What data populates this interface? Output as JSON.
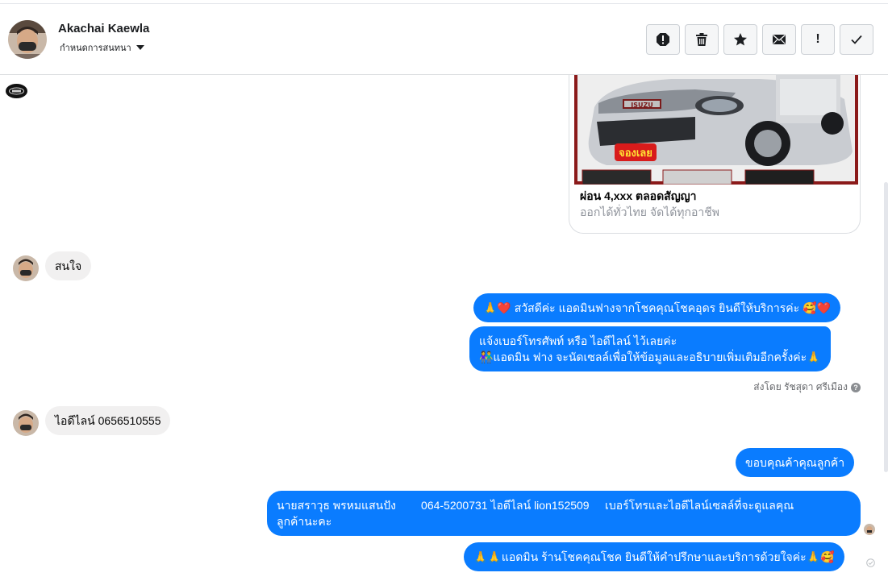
{
  "header": {
    "user_name": "Akachai Kaewla",
    "conversation_label": "กำหนดการสนทนา",
    "actions": [
      {
        "name": "report-icon",
        "label": "!"
      },
      {
        "name": "trash-icon"
      },
      {
        "name": "star-icon"
      },
      {
        "name": "mail-icon"
      },
      {
        "name": "mark-important-icon",
        "label": "!"
      },
      {
        "name": "checkmark-icon"
      }
    ]
  },
  "ad_card": {
    "title": "ผ่อน 4,xxx ตลอดสัญญา",
    "subtitle": "ออกได้ทั่วไทย จัดได้ทุกอาชีพ",
    "image_caption": "จองเลย",
    "image_brand": "ISUZU"
  },
  "messages": [
    {
      "dir": "in",
      "text": "สนใจ"
    },
    {
      "dir": "out",
      "text": "🙏❤️ สวัสดีค่ะ แอดมินฟางจากโชคคุณโชคอุดร ยินดีให้บริการค่ะ 🥰❤️"
    },
    {
      "dir": "out",
      "line1": "แจ้งเบอร์โทรศัพท์ หรือ ไอดีไลน์  ไว้เลยค่ะ",
      "line2": "👫แอดมิน ฟาง จะนัดเซลล์เพื่อให้ข้อมูลและอธิบายเพิ่มเติมอีกครั้งค่ะ🙏"
    },
    {
      "dir": "in",
      "text": "ไอดีไลน์ 0656510555"
    },
    {
      "dir": "out",
      "text": "ขอบคุณค้าคุณลูกค้า"
    },
    {
      "dir": "out",
      "line1": "นายสราวุธ พรหมแสนปัง        064-5200731 ไอดีไลน์ lion152509     เบอร์โทรและไอดีไลน์เซลล์ที่จะดูแลคุณ",
      "line2": "ลูกค้านะคะ"
    },
    {
      "dir": "out",
      "text": "🙏🙏แอดมิน ร้านโชคคุณโชค ยินดีให้คำปรึกษาและบริการด้วยใจค่ะ🙏🥰"
    }
  ],
  "sent_by": "ส่งโดย รัชสุดา ศรีเมือง",
  "colors": {
    "outgoing_bubble": "#0a7cff",
    "incoming_bubble": "#f1f0f0",
    "header_border": "#dddfe2"
  }
}
